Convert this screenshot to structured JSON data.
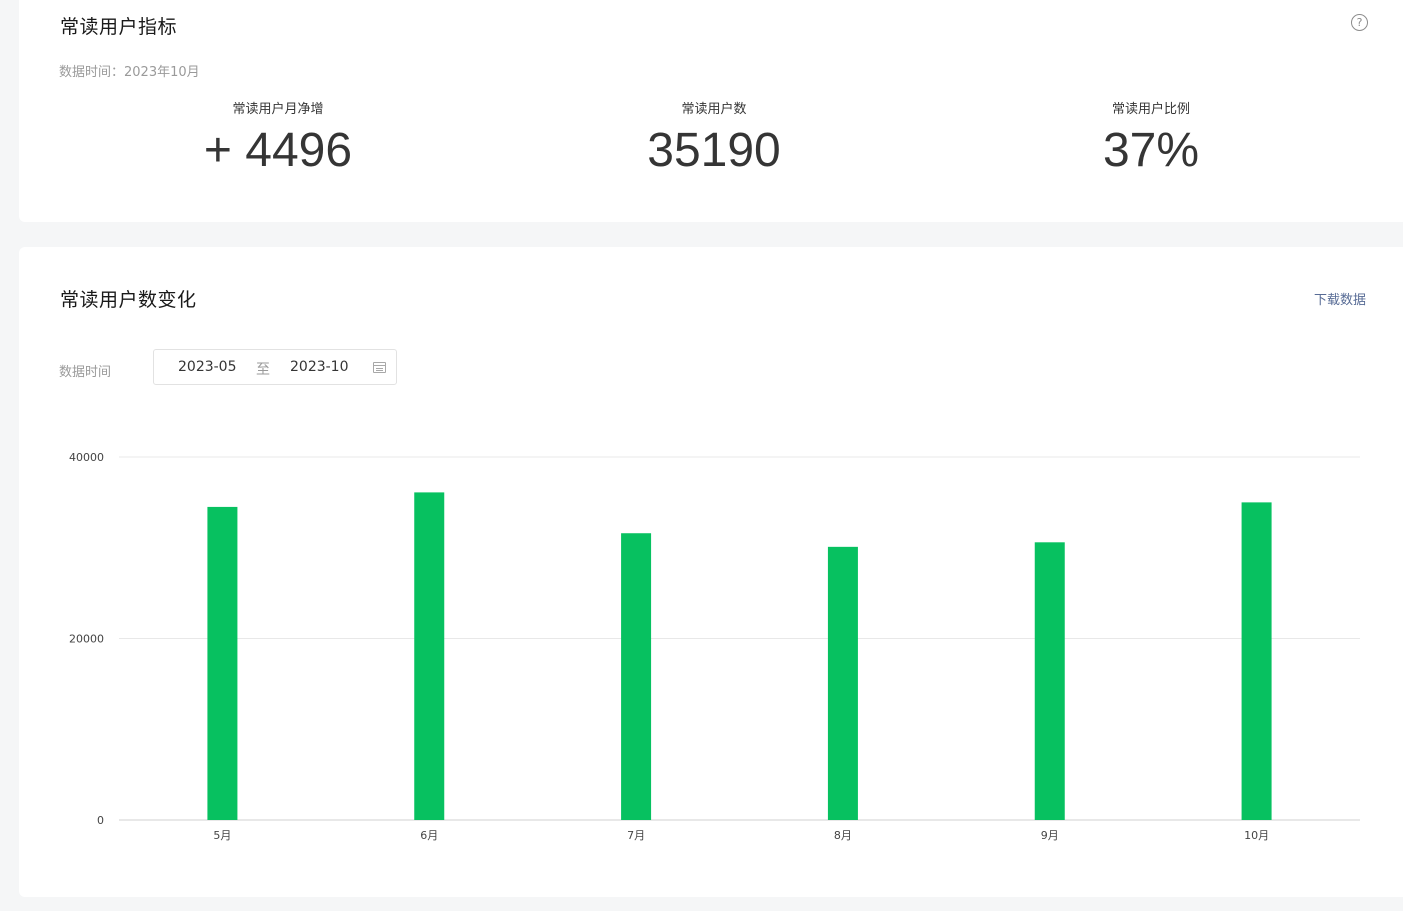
{
  "metrics_card": {
    "title": "常读用户指标",
    "data_time": "数据时间：2023年10月",
    "help_icon": "help-circle-icon",
    "metrics": [
      {
        "label": "常读用户月净增",
        "value": "+ 4496"
      },
      {
        "label": "常读用户数",
        "value": "35190"
      },
      {
        "label": "常读用户比例",
        "value": "37%"
      }
    ]
  },
  "chart_card": {
    "title": "常读用户数变化",
    "download_label": "下载数据",
    "data_time_label": "数据时间",
    "date_start": "2023-05",
    "date_separator": "至",
    "date_end": "2023-10",
    "calendar_icon": "calendar-icon"
  },
  "chart_data": {
    "type": "bar",
    "categories": [
      "5月",
      "6月",
      "7月",
      "8月",
      "9月",
      "10月"
    ],
    "values": [
      34500,
      36100,
      31600,
      30100,
      30600,
      35000
    ],
    "yticks": [
      0,
      20000,
      40000
    ],
    "ylim": [
      0,
      40000
    ],
    "bar_color": "#07c160",
    "grid": true
  }
}
